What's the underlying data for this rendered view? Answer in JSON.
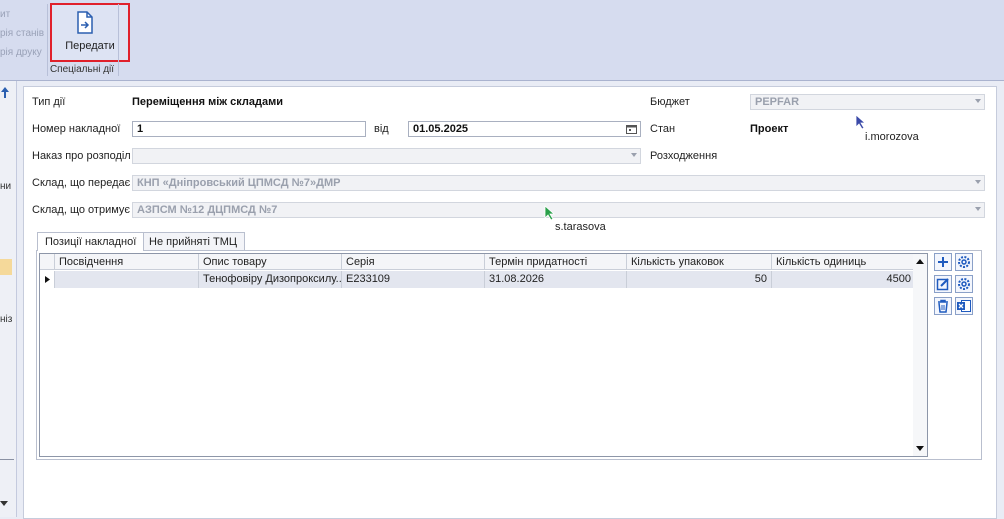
{
  "ribbon": {
    "faded_items": [
      "ит",
      "рія станів",
      "рія друку"
    ],
    "transfer_label": "Передати",
    "group_label": "Спеціальні дії"
  },
  "left_strip": [
    "ни",
    "ніз"
  ],
  "form": {
    "action_type_label": "Тип дії",
    "action_type_value": "Переміщення між складами",
    "invoice_number_label": "Номер накладної",
    "invoice_number_value": "1",
    "date_label": "від",
    "date_value": "01.05.2025",
    "order_label": "Наказ про розподіл",
    "order_value": "",
    "sender_label": "Склад, що передає",
    "sender_value": "КНП «Дніпровський ЦПМСД №7»ДМР",
    "receiver_label": "Склад, що отримує",
    "receiver_value": "АЗПСМ №12 ДЦПМСД №7",
    "budget_label": "Бюджет",
    "budget_value": "PEPFAR",
    "state_label": "Стан",
    "state_value": "Проект",
    "discrepancy_label": "Розходження"
  },
  "tabs": [
    "Позиції накладної",
    "Не прийняті ТМЦ"
  ],
  "table": {
    "columns": [
      "Посвідчення",
      "Опис товару",
      "Серія",
      "Термін придатності",
      "Кількість упаковок",
      "Кількість одиниць"
    ],
    "rows": [
      [
        "",
        "Тенофовіру Дизопроксилу...",
        "E233109",
        "31.08.2026",
        "50",
        "4500"
      ]
    ]
  },
  "cursors": {
    "user1": "i.morozova",
    "user2": "s.tarasova"
  }
}
